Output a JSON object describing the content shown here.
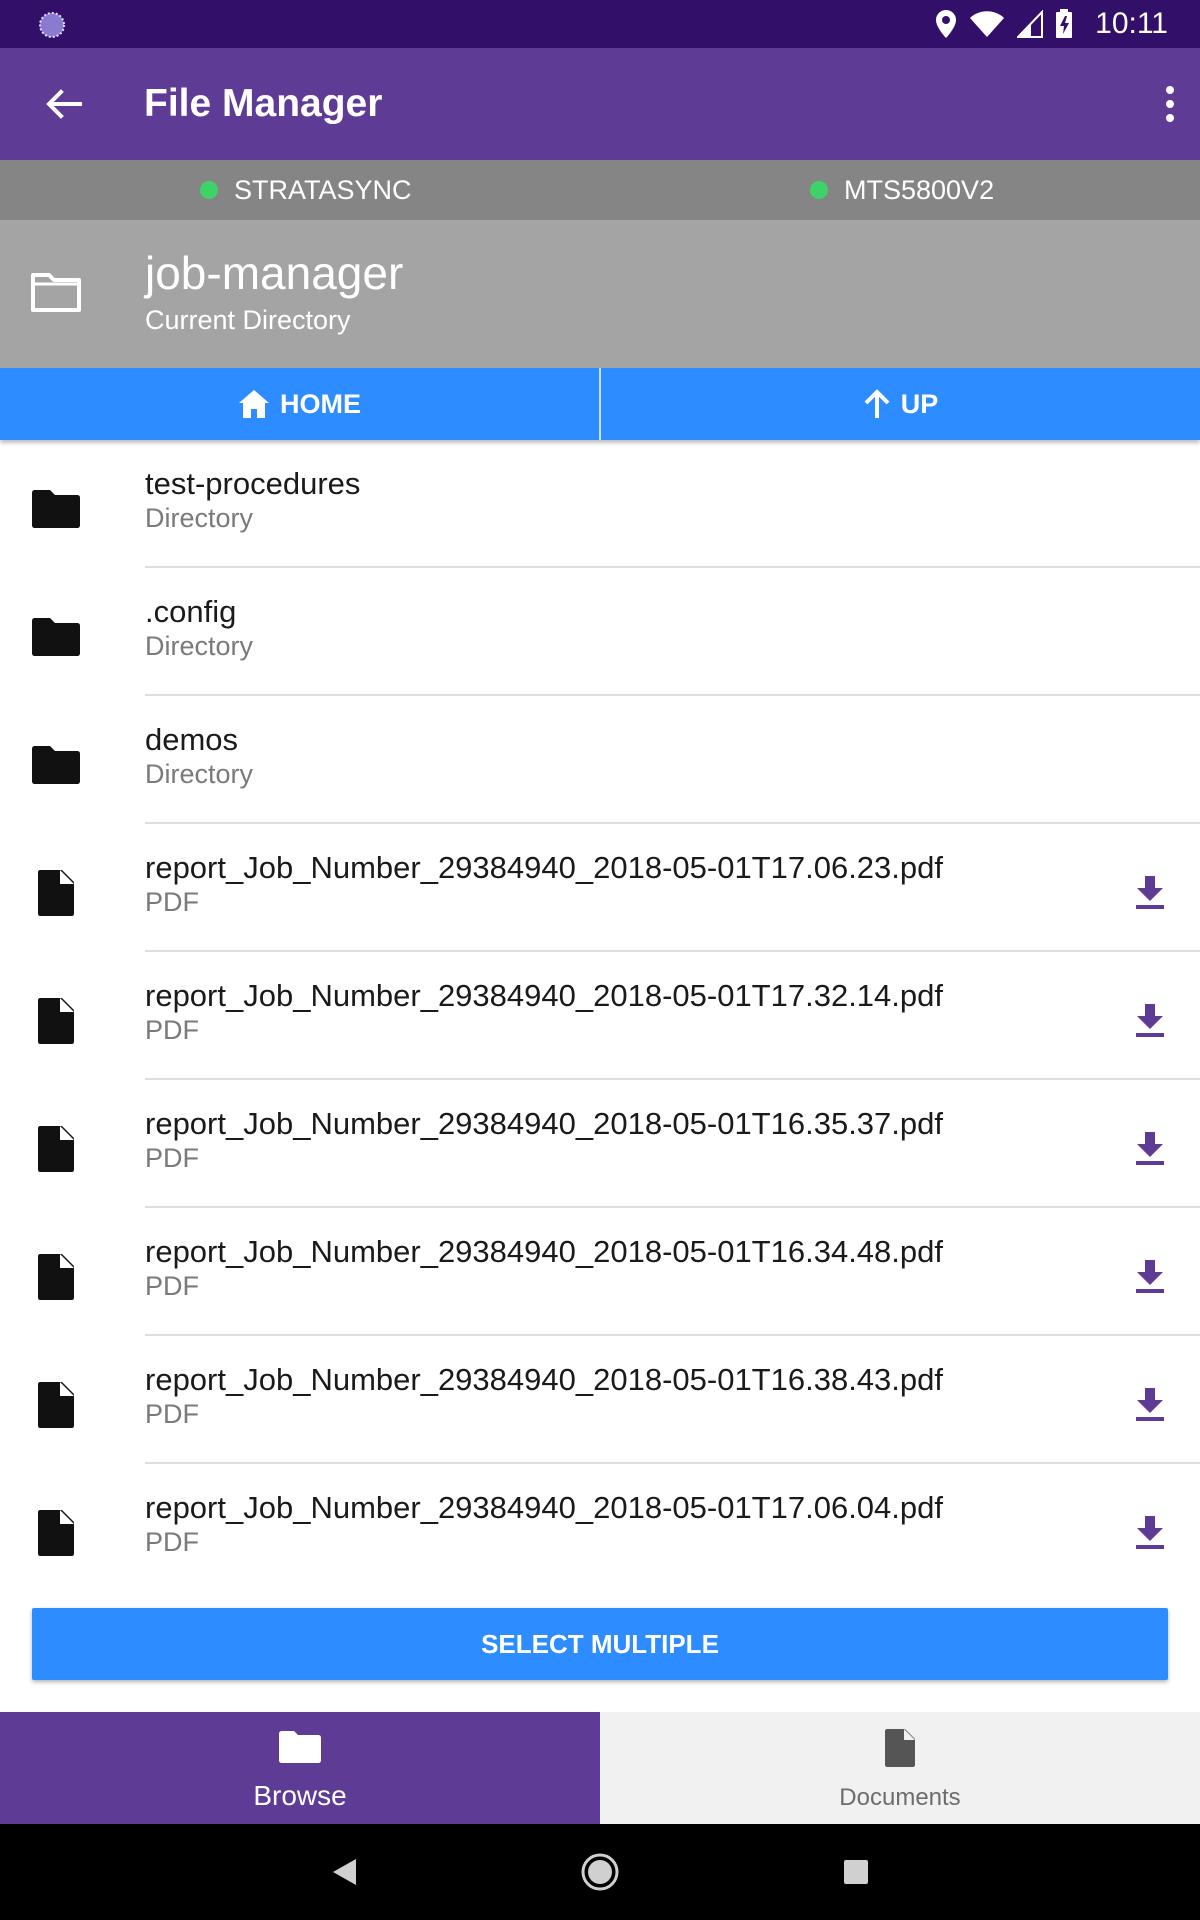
{
  "status_bar": {
    "time": "10:11"
  },
  "app_bar": {
    "title": "File Manager"
  },
  "connections": [
    {
      "label": "STRATASYNC",
      "status_color": "#3fd268"
    },
    {
      "label": "MTS5800V2",
      "status_color": "#3fd268"
    }
  ],
  "current_directory": {
    "name": "job-manager",
    "subtitle": "Current Directory"
  },
  "nav": {
    "home_label": "HOME",
    "up_label": "UP"
  },
  "files": [
    {
      "name": "test-procedures",
      "type": "Directory",
      "icon": "folder-icon"
    },
    {
      "name": ".config",
      "type": "Directory",
      "icon": "folder-icon"
    },
    {
      "name": "demos",
      "type": "Directory",
      "icon": "folder-icon"
    },
    {
      "name": "report_Job_Number_29384940_2018-05-01T17.06.23.pdf",
      "type": "PDF",
      "icon": "file-icon"
    },
    {
      "name": "report_Job_Number_29384940_2018-05-01T17.32.14.pdf",
      "type": "PDF",
      "icon": "file-icon"
    },
    {
      "name": "report_Job_Number_29384940_2018-05-01T16.35.37.pdf",
      "type": "PDF",
      "icon": "file-icon"
    },
    {
      "name": "report_Job_Number_29384940_2018-05-01T16.34.48.pdf",
      "type": "PDF",
      "icon": "file-icon"
    },
    {
      "name": "report_Job_Number_29384940_2018-05-01T16.38.43.pdf",
      "type": "PDF",
      "icon": "file-icon"
    },
    {
      "name": "report_Job_Number_29384940_2018-05-01T17.06.04.pdf",
      "type": "PDF",
      "icon": "file-icon"
    }
  ],
  "actions": {
    "select_multiple": "SELECT MULTIPLE"
  },
  "bottom_nav": {
    "browse_label": "Browse",
    "documents_label": "Documents"
  },
  "colors": {
    "accent_blue": "#2d8cff",
    "brand_purple": "#5e3b95",
    "status_bar": "#321069",
    "download_icon": "#5e3b95"
  }
}
